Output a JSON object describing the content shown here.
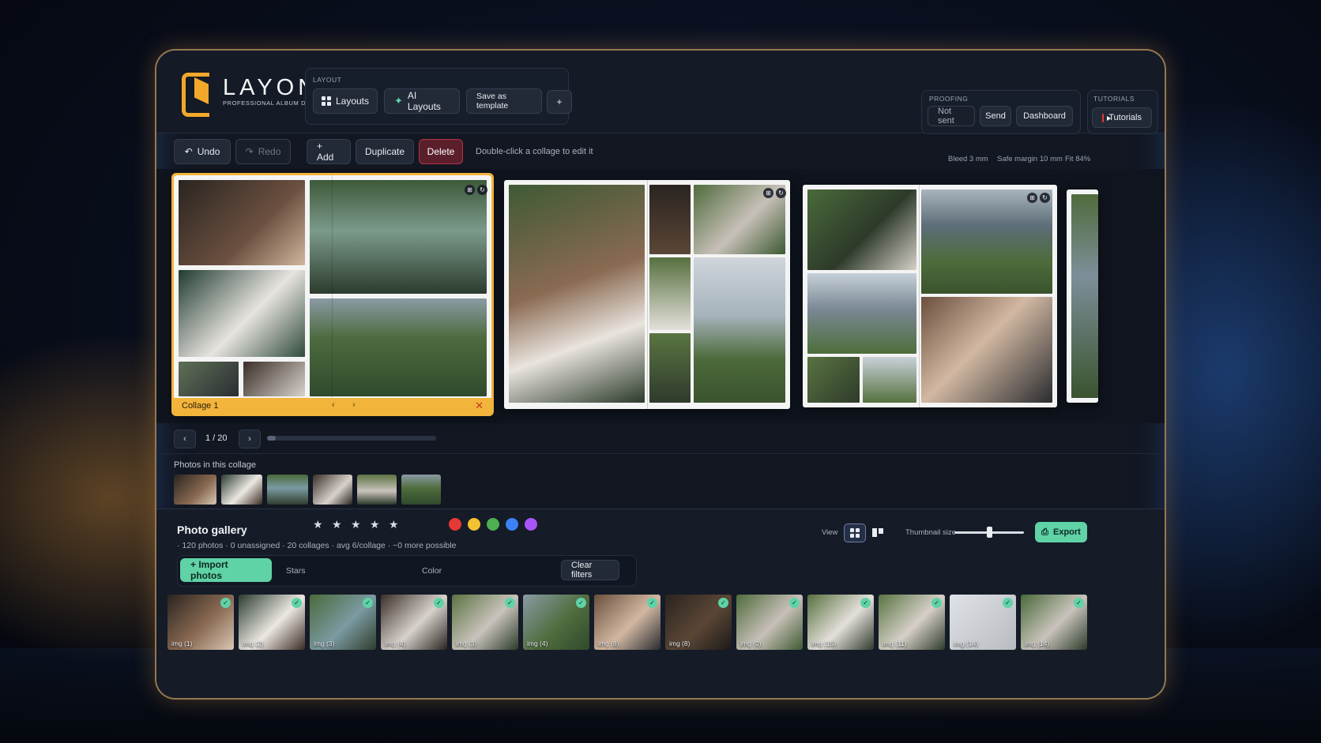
{
  "app": {
    "brand": "LAYON",
    "tagline": "PROFESSIONAL ALBUM DESIGN"
  },
  "layout_group": {
    "label": "LAYOUT",
    "layouts": "Layouts",
    "ai_layouts": "AI Layouts",
    "save_template": "Save as template",
    "plus": "+"
  },
  "proofing": {
    "label": "PROOFING",
    "not_sent": "Not sent",
    "send": "Send",
    "dashboard": "Dashboard"
  },
  "tutorials": {
    "label": "TUTORIALS",
    "button": "Tutorials",
    "icon": "youtube-icon"
  },
  "edit_bar": {
    "undo": "Undo",
    "redo": "Redo",
    "add": "+ Add",
    "duplicate": "Duplicate",
    "delete": "Delete",
    "hint": "Double-click a collage to edit it",
    "bleed": "Bleed 3 mm",
    "safe_margin": "Safe margin 10 mm",
    "fit": "Fit 84%"
  },
  "canvas": {
    "active_collage": "Collage 1",
    "nav_prev": "‹",
    "nav_next": "›",
    "close": "✕"
  },
  "pager": {
    "prev": "‹",
    "next": "›",
    "page": "1 / 20",
    "progress": 0.05
  },
  "collage_photos": {
    "label": "Photos in this collage",
    "count": 6
  },
  "gallery": {
    "title": "Photo gallery",
    "stats": "· 120 photos  · 0 unassigned  · 20 collages  · avg 6/collage  · ~0 more possible",
    "view_label": "View",
    "thumb_size_label": "Thumbnail size",
    "thumb_size": 0.5,
    "export": "Export",
    "import": "+ Import photos",
    "stars_label": "Stars",
    "stars": "★",
    "color_label": "Color",
    "colors": [
      "#e53935",
      "#f2c230",
      "#4caf50",
      "#3b82f6",
      "#a855f7"
    ],
    "clear_filters": "Clear filters",
    "items": [
      {
        "label": "img (1)"
      },
      {
        "label": "img (2)"
      },
      {
        "label": "img (3)"
      },
      {
        "label": "img (4)"
      },
      {
        "label": "img (3)"
      },
      {
        "label": "img (4)"
      },
      {
        "label": "img (8)"
      },
      {
        "label": "img (8)"
      },
      {
        "label": "img (0)"
      },
      {
        "label": "img (15)"
      },
      {
        "label": "img (11)"
      },
      {
        "label": "img (14)"
      },
      {
        "label": "img (14)"
      }
    ]
  },
  "colors": {
    "accent": "#5fd2a6",
    "selection": "#f2b43a",
    "danger": "#b53348"
  }
}
